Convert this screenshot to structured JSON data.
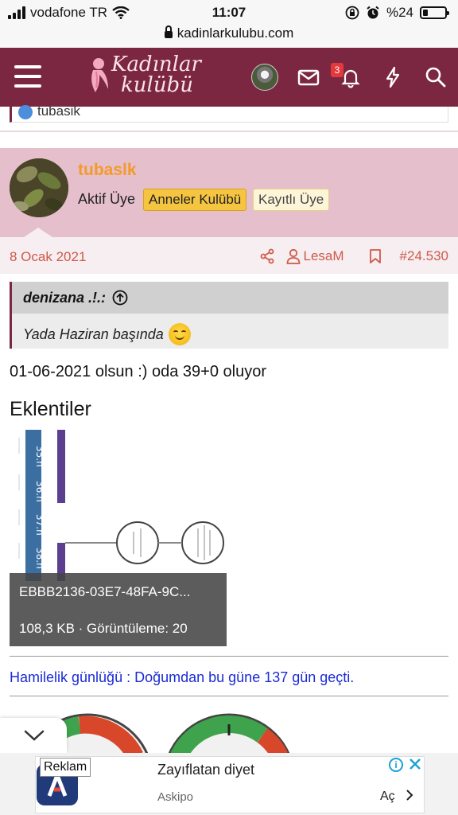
{
  "status_bar": {
    "carrier": "vodafone TR",
    "time": "11:07",
    "battery": "%24",
    "battery_level": 0.24
  },
  "browser": {
    "url": "kadinlarkulubu.com"
  },
  "header": {
    "logo_line1": "Kadınlar",
    "logo_line2": "kulübü",
    "notification_count": "3",
    "brand_color": "#7c2741"
  },
  "previous_post": {
    "username": "tubasik"
  },
  "post": {
    "username": "tubaslk",
    "user_title": "Aktif Üye",
    "badge_primary": "Anneler Kulübü",
    "badge_secondary": "Kayıtlı Üye",
    "date": "8 Ocak 2021",
    "liked_by": "LesaM",
    "post_number": "#24.530",
    "quote": {
      "author": "denizana .!.:",
      "text": "Yada Haziran başında"
    },
    "text": "01-06-2021 olsun :) oda 39+0 oluyor",
    "attachments_title": "Eklentiler",
    "attachment": {
      "filename": "EBBB2136-03E7-48FA-9C...",
      "info": "108,3 KB · Görüntüleme: 20",
      "image_labels": [
        "35.h",
        "36.h",
        "37.h",
        "38.h"
      ]
    },
    "signature": "Hamilelik günlüğü : Doğumdan bu güne 137 gün geçti."
  },
  "ad": {
    "label": "Reklam",
    "title": "Zayıflatan diyet",
    "source": "Askipo",
    "cta": "Aç",
    "info_glyph": "i"
  }
}
